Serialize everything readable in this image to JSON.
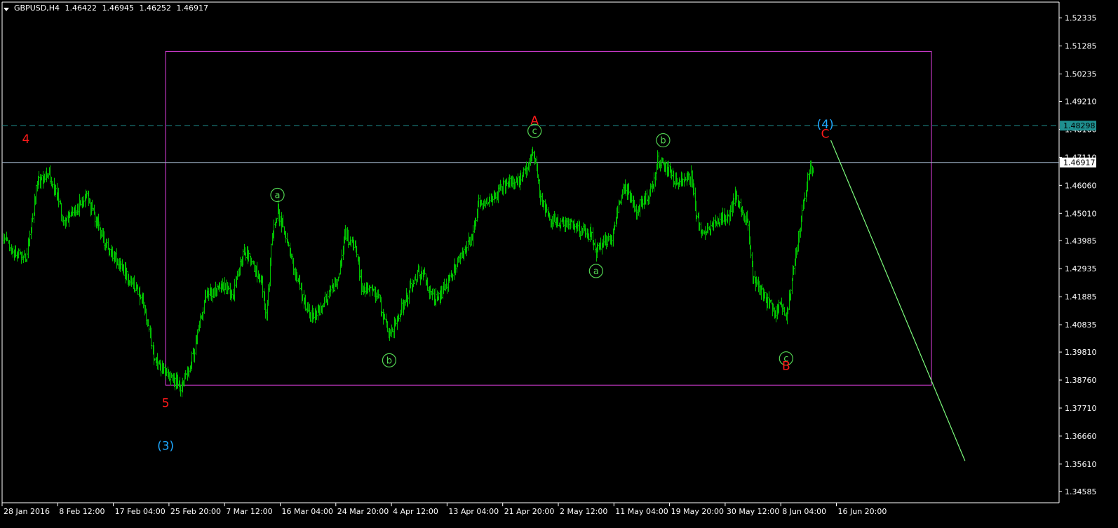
{
  "header": {
    "symbol_label": "GBPUSD,H4",
    "open": "1.46422",
    "high": "1.46945",
    "low": "1.46252",
    "close": "1.46917"
  },
  "colors": {
    "background": "#000000",
    "candles": "#00c000",
    "axis": "#ffffff",
    "rectangle": "#e040e0",
    "dashed_line": "#1f8f8f",
    "bid_line": "#a0b4c8",
    "trend_line": "#7cfc7c",
    "wave_red": "#ff1a1a",
    "wave_blue": "#1ea8ff",
    "wave_green": "#52d452"
  },
  "chart_data": {
    "type": "candlestick",
    "symbol": "GBPUSD",
    "timeframe": "H4",
    "y_ticks": [
      "1.52335",
      "1.51285",
      "1.50235",
      "1.49210",
      "1.48160",
      "1.47110",
      "1.46060",
      "1.45010",
      "1.43985",
      "1.42935",
      "1.41885",
      "1.40835",
      "1.39810",
      "1.38760",
      "1.37710",
      "1.36660",
      "1.35610",
      "1.34585"
    ],
    "ylim": [
      1.3416,
      1.5293
    ],
    "x_ticks": [
      "28 Jan 2016",
      "8 Feb 12:00",
      "17 Feb 04:00",
      "25 Feb 20:00",
      "7 Mar 12:00",
      "16 Mar 04:00",
      "24 Mar 20:00",
      "4 Apr 12:00",
      "13 Apr 04:00",
      "21 Apr 20:00",
      "2 May 12:00",
      "11 May 04:00",
      "19 May 20:00",
      "30 May 12:00",
      "8 Jun 04:00",
      "16 Jun 20:00"
    ],
    "bid_price": "1.46917",
    "dashed_level": "1.48298",
    "price_path": [
      [
        "28 Jan 2016",
        1.44
      ],
      [
        "1 Feb 2016",
        1.432
      ],
      [
        "3 Feb 2016",
        1.461
      ],
      [
        "5 Feb 2016",
        1.466
      ],
      [
        "8 Feb 2016",
        1.447
      ],
      [
        "10 Feb 2016",
        1.452
      ],
      [
        "12 Feb 2016",
        1.456
      ],
      [
        "15 Feb 2016",
        1.44
      ],
      [
        "17 Feb 2016",
        1.433
      ],
      [
        "19 Feb 2016",
        1.427
      ],
      [
        "22 Feb 2016",
        1.417
      ],
      [
        "23 Feb 2016",
        1.406
      ],
      [
        "24 Feb 2016",
        1.395
      ],
      [
        "26 Feb 2016",
        1.39
      ],
      [
        "29 Feb 2016",
        1.385
      ],
      [
        "2 Mar 2016",
        1.398
      ],
      [
        "4 Mar 2016",
        1.418
      ],
      [
        "7 Mar 2016",
        1.424
      ],
      [
        "9 Mar 2016",
        1.419
      ],
      [
        "11 Mar 2016",
        1.436
      ],
      [
        "14 Mar 2016",
        1.426
      ],
      [
        "15 Mar 2016",
        1.41
      ],
      [
        "16 Mar 2016",
        1.442
      ],
      [
        "17 Mar 2016",
        1.451
      ],
      [
        "18 Mar 2016",
        1.445
      ],
      [
        "22 Mar 2016",
        1.415
      ],
      [
        "23 Mar 2016",
        1.411
      ],
      [
        "25 Mar 2016",
        1.415
      ],
      [
        "28 Mar 2016",
        1.427
      ],
      [
        "29 Mar 2016",
        1.442
      ],
      [
        "31 Mar 2016",
        1.437
      ],
      [
        "1 Apr 2016",
        1.423
      ],
      [
        "4 Apr 2016",
        1.419
      ],
      [
        "5 Apr 2016",
        1.41
      ],
      [
        "6 Apr 2016",
        1.406
      ],
      [
        "7 Apr 2016",
        1.408
      ],
      [
        "8 Apr 2016",
        1.414
      ],
      [
        "11 Apr 2016",
        1.427
      ],
      [
        "12 Apr 2016",
        1.428
      ],
      [
        "13 Apr 2016",
        1.421
      ],
      [
        "14 Apr 2016",
        1.418
      ],
      [
        "15 Apr 2016",
        1.419
      ],
      [
        "18 Apr 2016",
        1.431
      ],
      [
        "20 Apr 2016",
        1.438
      ],
      [
        "21 Apr 2016",
        1.442
      ],
      [
        "22 Apr 2016",
        1.454
      ],
      [
        "25 Apr 2016",
        1.456
      ],
      [
        "26 Apr 2016",
        1.46
      ],
      [
        "28 Apr 2016",
        1.462
      ],
      [
        "29 Apr 2016",
        1.462
      ],
      [
        "2 May 2016",
        1.472
      ],
      [
        "3 May 2016",
        1.456
      ],
      [
        "4 May 2016",
        1.452
      ],
      [
        "5 May 2016",
        1.448
      ],
      [
        "6 May 2016",
        1.446
      ],
      [
        "9 May 2016",
        1.445
      ],
      [
        "10 May 2016",
        1.444
      ],
      [
        "11 May 2016",
        1.443
      ],
      [
        "12 May 2016",
        1.442
      ],
      [
        "13 May 2016",
        1.436
      ],
      [
        "16 May 2016",
        1.442
      ],
      [
        "17 May 2016",
        1.453
      ],
      [
        "18 May 2016",
        1.461
      ],
      [
        "19 May 2016",
        1.456
      ],
      [
        "20 May 2016",
        1.451
      ],
      [
        "23 May 2016",
        1.459
      ],
      [
        "24 May 2016",
        1.47
      ],
      [
        "25 May 2016",
        1.468
      ],
      [
        "26 May 2016",
        1.466
      ],
      [
        "27 May 2016",
        1.463
      ],
      [
        "30 May 2016",
        1.464
      ],
      [
        "31 May 2016",
        1.448
      ],
      [
        "1 Jun 2016",
        1.441
      ],
      [
        "2 Jun 2016",
        1.443
      ],
      [
        "3 Jun 2016",
        1.447
      ],
      [
        "6 Jun 2016",
        1.45
      ],
      [
        "7 Jun 2016",
        1.457
      ],
      [
        "8 Jun 2016",
        1.451
      ],
      [
        "9 Jun 2016",
        1.448
      ],
      [
        "10 Jun 2016",
        1.426
      ],
      [
        "13 Jun 2016",
        1.416
      ],
      [
        "14 Jun 2016",
        1.413
      ],
      [
        "15 Jun 2016",
        1.417
      ],
      [
        "16 Jun 2016",
        1.41
      ],
      [
        "17 Jun 2016",
        1.425
      ],
      [
        "20 Jun 2016",
        1.465
      ],
      [
        "21 Jun 2016",
        1.468
      ]
    ],
    "wave_labels": [
      {
        "text": "4",
        "color": "red",
        "x": "1 Feb 2016",
        "y": 1.478
      },
      {
        "text": "5",
        "color": "red",
        "x": "26 Feb 2016",
        "y": 1.379
      },
      {
        "text": "(3)",
        "color": "blue",
        "x": "26 Feb 2016",
        "y": 1.363
      },
      {
        "text": "a",
        "color": "green",
        "x": "17 Mar 2016",
        "y": 1.457
      },
      {
        "text": "b",
        "color": "green",
        "x": "6 Apr 2016",
        "y": 1.395
      },
      {
        "text": "c",
        "color": "green",
        "x": "2 May 2016",
        "y": 1.481
      },
      {
        "text": "A",
        "color": "red",
        "x": "2 May 2016",
        "y": 1.485
      },
      {
        "text": "a",
        "color": "green",
        "x": "13 May 2016",
        "y": 1.4285
      },
      {
        "text": "b",
        "color": "green",
        "x": "25 May 2016",
        "y": 1.4775
      },
      {
        "text": "c",
        "color": "green",
        "x": "16 Jun 2016",
        "y": 1.3957
      },
      {
        "text": "B",
        "color": "red",
        "x": "16 Jun 2016",
        "y": 1.393
      },
      {
        "text": "(4)",
        "color": "blue",
        "x": "23 Jun 2016",
        "y": 1.4835
      },
      {
        "text": "C",
        "color": "red",
        "x": "23 Jun 2016",
        "y": 1.48
      }
    ],
    "rectangle": {
      "x_start": "26 Feb 2016",
      "x_end": "12 Jul 2016",
      "y_top": 1.5108,
      "y_bottom": 1.3857
    },
    "trend_line": {
      "x_start": "24 Jun 2016",
      "y_start": 1.4775,
      "x_end": "18 Jul 2016",
      "y_end": 1.3573
    }
  }
}
